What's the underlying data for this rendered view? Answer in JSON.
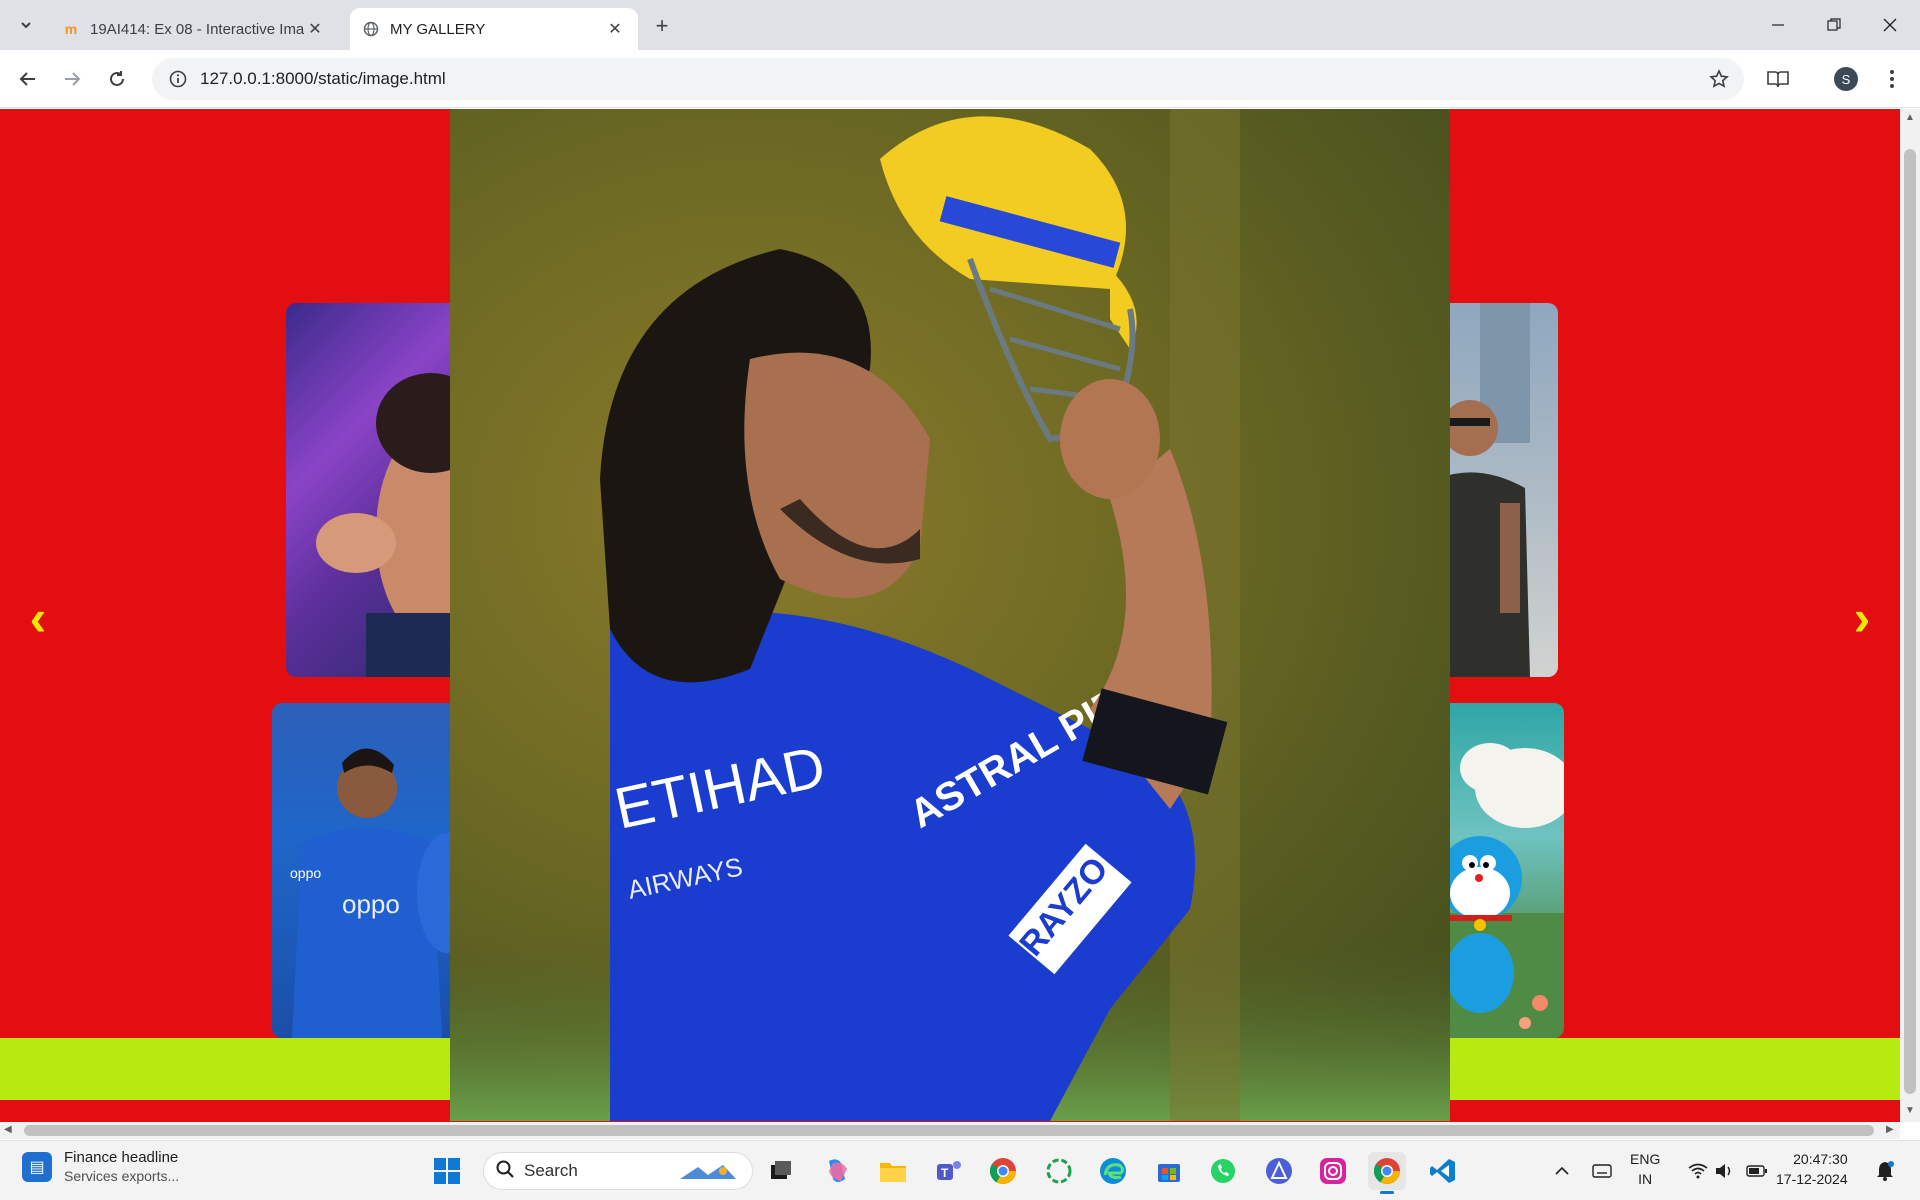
{
  "browser": {
    "tabs": [
      {
        "title": "19AI414: Ex 08 - Interactive Ima",
        "favicon": "m",
        "active": false
      },
      {
        "title": "MY GALLERY",
        "favicon": "globe-icon",
        "active": true
      }
    ],
    "new_tab": "+",
    "address": "127.0.0.1:8000/static/image.html",
    "profile_initial": "S"
  },
  "page": {
    "background_color": "#e20e10",
    "bar_color": "#b6ea10",
    "arrow_color": "#f0e800",
    "prev_arrow": "‹",
    "next_arrow": "›",
    "main_image_text": {
      "sponsor1": "ASTRAL PIPES",
      "sponsor2": "RAYZO",
      "chest": "ETIHAD",
      "chest_sub": "AIRWAYS"
    }
  },
  "taskbar": {
    "news_title": "Finance headline",
    "news_sub": "Services exports...",
    "search_label": "Search",
    "lang_top": "ENG",
    "lang_bottom": "IN",
    "time": "20:47:30",
    "date": "17-12-2024"
  }
}
